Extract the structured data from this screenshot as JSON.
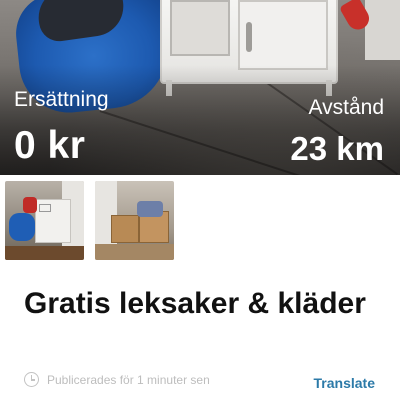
{
  "hero": {
    "compensation_label": "Ersättning",
    "compensation_value": "0 kr",
    "distance_label": "Avstånd",
    "distance_value": "23 km"
  },
  "thumbnails": [
    {
      "icon": "photo-kitchen-and-bags"
    },
    {
      "icon": "photo-boxes"
    }
  ],
  "listing": {
    "title": "Gratis leksaker & kläder",
    "published": "Publicerades för 1 minuter sen",
    "translate_label": "Translate"
  },
  "colors": {
    "title": "#111111",
    "translate": "#2c7aa8",
    "meta": "#bdbdbd",
    "overlay_text": "#ffffff"
  }
}
